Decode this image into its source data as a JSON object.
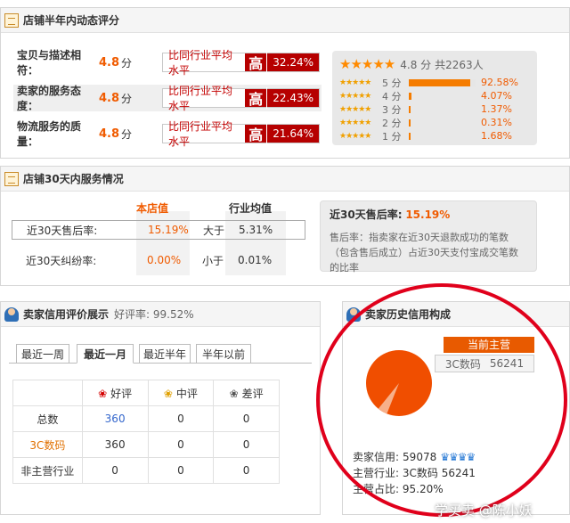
{
  "shop_ratings": {
    "title": "店铺半年内动态评分",
    "rows": [
      {
        "label": "宝贝与描述相符：",
        "score": "4.8",
        "unit": "分",
        "compare": "比同行业平均水平",
        "level": "高",
        "pct": "32.24%"
      },
      {
        "label": "卖家的服务态度：",
        "score": "4.8",
        "unit": "分",
        "compare": "比同行业平均水平",
        "level": "高",
        "pct": "22.43%"
      },
      {
        "label": "物流服务的质量：",
        "score": "4.8",
        "unit": "分",
        "compare": "比同行业平均水平",
        "level": "高",
        "pct": "21.64%"
      }
    ],
    "summary": {
      "stars": "★★★★★",
      "score": "4.8 分",
      "count": "共2263人"
    },
    "breakdown": [
      {
        "stars": "★★★★★",
        "label": "5 分",
        "pct": "92.58%",
        "fill": 0.9258
      },
      {
        "stars": "★★★★★",
        "label": "4 分",
        "pct": "4.07%",
        "fill": 0.0407
      },
      {
        "stars": "★★★★★",
        "label": "3 分",
        "pct": "1.37%",
        "fill": 0.0137
      },
      {
        "stars": "★★★★★",
        "label": "2 分",
        "pct": "0.31%",
        "fill": 0.0031
      },
      {
        "stars": "★★★★★",
        "label": "1 分",
        "pct": "1.68%",
        "fill": 0.0168
      }
    ]
  },
  "service30": {
    "title": "店铺30天内服务情况",
    "col_shop": "本店值",
    "col_industry": "行业均值",
    "rows": [
      {
        "label": "近30天售后率:",
        "shop": "15.19%",
        "cmp": "大于",
        "industry": "5.31%"
      },
      {
        "label": "近30天纠纷率:",
        "shop": "0.00%",
        "cmp": "小于",
        "industry": "0.01%"
      }
    ],
    "info_title": "近30天售后率:",
    "info_value": "15.19%",
    "info_desc": "售后率：指卖家在近30天退款成功的笔数（包含售后成立）占近30天支付宝成交笔数的比率"
  },
  "credit": {
    "title": "卖家信用评价展示",
    "good_rate_label": "好评率: 99.52%",
    "tabs": [
      "最近一周",
      "最近一月",
      "最近半年",
      "半年以前"
    ],
    "active_tab": 1,
    "headers": [
      "好评",
      "中评",
      "差评"
    ],
    "rows": [
      {
        "label": "总数",
        "good": "360",
        "mid": "0",
        "bad": "0"
      },
      {
        "label": "3C数码",
        "good": "360",
        "mid": "0",
        "bad": "0"
      },
      {
        "label": "非主营行业",
        "good": "0",
        "mid": "0",
        "bad": "0"
      }
    ]
  },
  "history": {
    "title": "卖家历史信用构成",
    "tag": "当前主营",
    "legend_text": "3C数码",
    "legend_value": "56241",
    "pie_share": 0.952,
    "seller_credit_label": "卖家信用:",
    "seller_credit_value": "59078",
    "main_industry_label": "主营行业:",
    "main_industry_value": "3C数码 56241",
    "main_share_label": "主营占比:",
    "main_share_value": "95.20%"
  },
  "watermark": "学买卖 @陈小妖",
  "colors": {
    "accent": "#f05b00",
    "badge": "#b60000",
    "circle": "#e0001b"
  }
}
